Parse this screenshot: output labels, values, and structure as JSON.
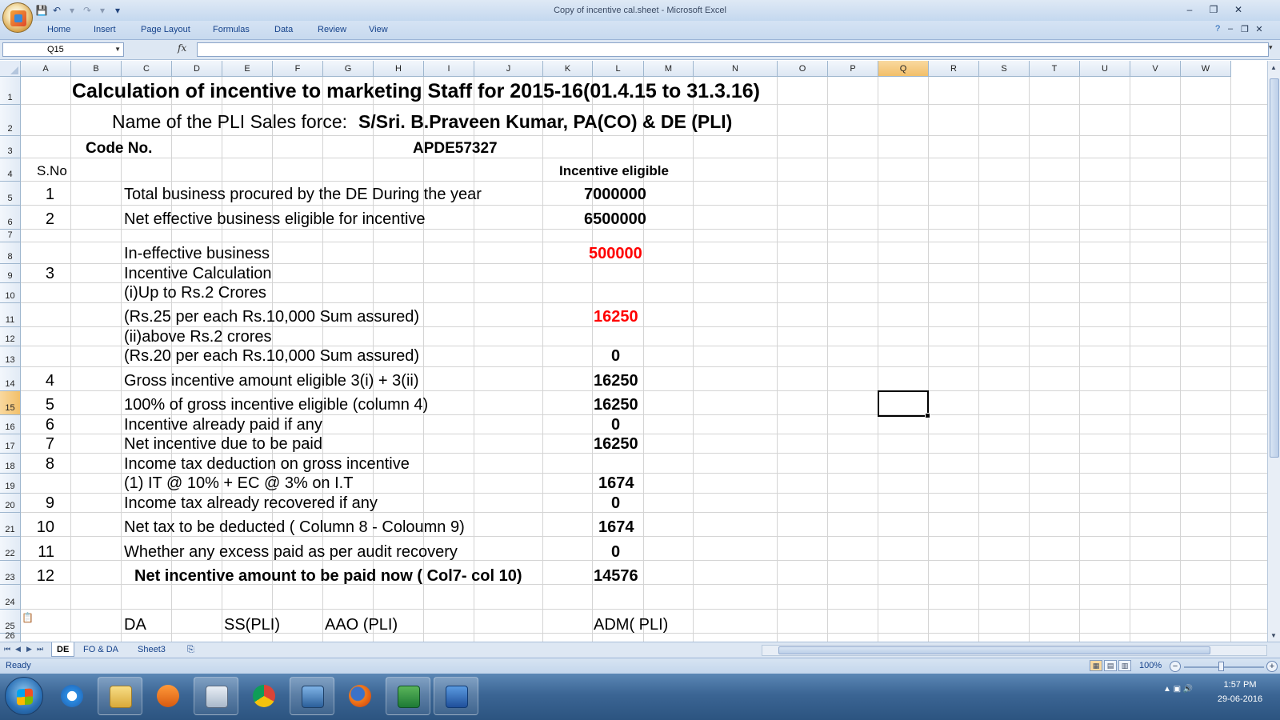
{
  "window": {
    "title": "Copy of incentive cal.sheet - Microsoft Excel",
    "controls": [
      "–",
      "❐",
      "✕"
    ]
  },
  "ribbon": {
    "tabs": [
      "Home",
      "Insert",
      "Page Layout",
      "Formulas",
      "Data",
      "Review",
      "View"
    ]
  },
  "formula_bar": {
    "name_box": "Q15",
    "fx": "fx",
    "formula": ""
  },
  "columns": [
    "A",
    "B",
    "C",
    "D",
    "E",
    "F",
    "G",
    "H",
    "I",
    "J",
    "K",
    "L",
    "M",
    "N",
    "O",
    "P",
    "Q",
    "R",
    "S",
    "T",
    "U",
    "V",
    "W"
  ],
  "rows": [
    "1",
    "2",
    "3",
    "4",
    "5",
    "6",
    "7",
    "8",
    "9",
    "10",
    "11",
    "12",
    "13",
    "14",
    "15",
    "16",
    "17",
    "18",
    "19",
    "20",
    "21",
    "22",
    "23",
    "24",
    "25",
    "26"
  ],
  "active_cell": {
    "column": "Q",
    "row": "15"
  },
  "sheet": {
    "title": "Calculation of incentive to marketing Staff for 2015-16(01.4.15 to 31.3.16)",
    "sales_force_label": "Name of the PLI Sales force:",
    "sales_force_name": "S/Sri. B.Praveen Kumar, PA(CO) &  DE (PLI)",
    "code_label": "Code No.",
    "code_value": "APDE57327",
    "sno_header": "S.No",
    "incentive_header": "Incentive eligible",
    "items": [
      {
        "sno": "1",
        "desc": "Total business procured by the DE During the year",
        "value": "7000000"
      },
      {
        "sno": "2",
        "desc": "Net effective business eligible for incentive",
        "value": "6500000"
      },
      {
        "sno": "",
        "desc": "In-effective business",
        "value": "500000"
      },
      {
        "sno": "3",
        "desc": "Incentive Calculation",
        "value": ""
      },
      {
        "sno": "",
        "desc": "(i)Up to Rs.2 Crores",
        "value": ""
      },
      {
        "sno": "",
        "desc": "(Rs.25 per each Rs.10,000 Sum assured)",
        "value": "16250"
      },
      {
        "sno": "",
        "desc": "(ii)above Rs.2 crores",
        "value": ""
      },
      {
        "sno": "",
        "desc": "(Rs.20 per each Rs.10,000 Sum assured)",
        "value": "0"
      },
      {
        "sno": "4",
        "desc": "Gross incentive amount eligible 3(i) + 3(ii)",
        "value": "16250"
      },
      {
        "sno": "5",
        "desc": "100% of gross incentive eligible (column 4)",
        "value": "16250"
      },
      {
        "sno": "6",
        "desc": "Incentive already paid if any",
        "value": "0"
      },
      {
        "sno": "7",
        "desc": "Net incentive due to be paid",
        "value": "16250"
      },
      {
        "sno": "8",
        "desc": "Income tax deduction on gross incentive",
        "value": ""
      },
      {
        "sno": "",
        "desc": "(1) IT @ 10% + EC @ 3% on I.T",
        "value": "1674"
      },
      {
        "sno": "9",
        "desc": "Income tax already recovered if any",
        "value": "0"
      },
      {
        "sno": "10",
        "desc": "Net tax to be deducted ( Column 8 - Coloumn 9)",
        "value": "1674"
      },
      {
        "sno": "11",
        "desc": "Whether any excess paid as per audit recovery",
        "value": "0"
      },
      {
        "sno": "12",
        "desc": "Net incentive amount to be paid now ( Col7- col 10)",
        "value": "14576"
      }
    ],
    "signatures": [
      "DA",
      "SS(PLI)",
      "AAO (PLI)",
      "ADM( PLI)"
    ],
    "colors": {
      "highlight_value": "#ff0000"
    }
  },
  "sheet_tabs": [
    "DE",
    "FO & DA",
    "Sheet3"
  ],
  "status": {
    "mode": "Ready",
    "zoom": "100%",
    "view_icons": [
      "normal-view-icon",
      "page-layout-view-icon",
      "page-break-view-icon"
    ]
  },
  "taskbar": {
    "apps": [
      "internet-explorer-icon",
      "file-explorer-icon",
      "media-player-icon",
      "calculator-icon",
      "chrome-icon",
      "remote-desktop-icon",
      "firefox-icon",
      "excel-icon",
      "word-icon"
    ],
    "time": "1:57 PM",
    "date": "29-06-2016"
  }
}
